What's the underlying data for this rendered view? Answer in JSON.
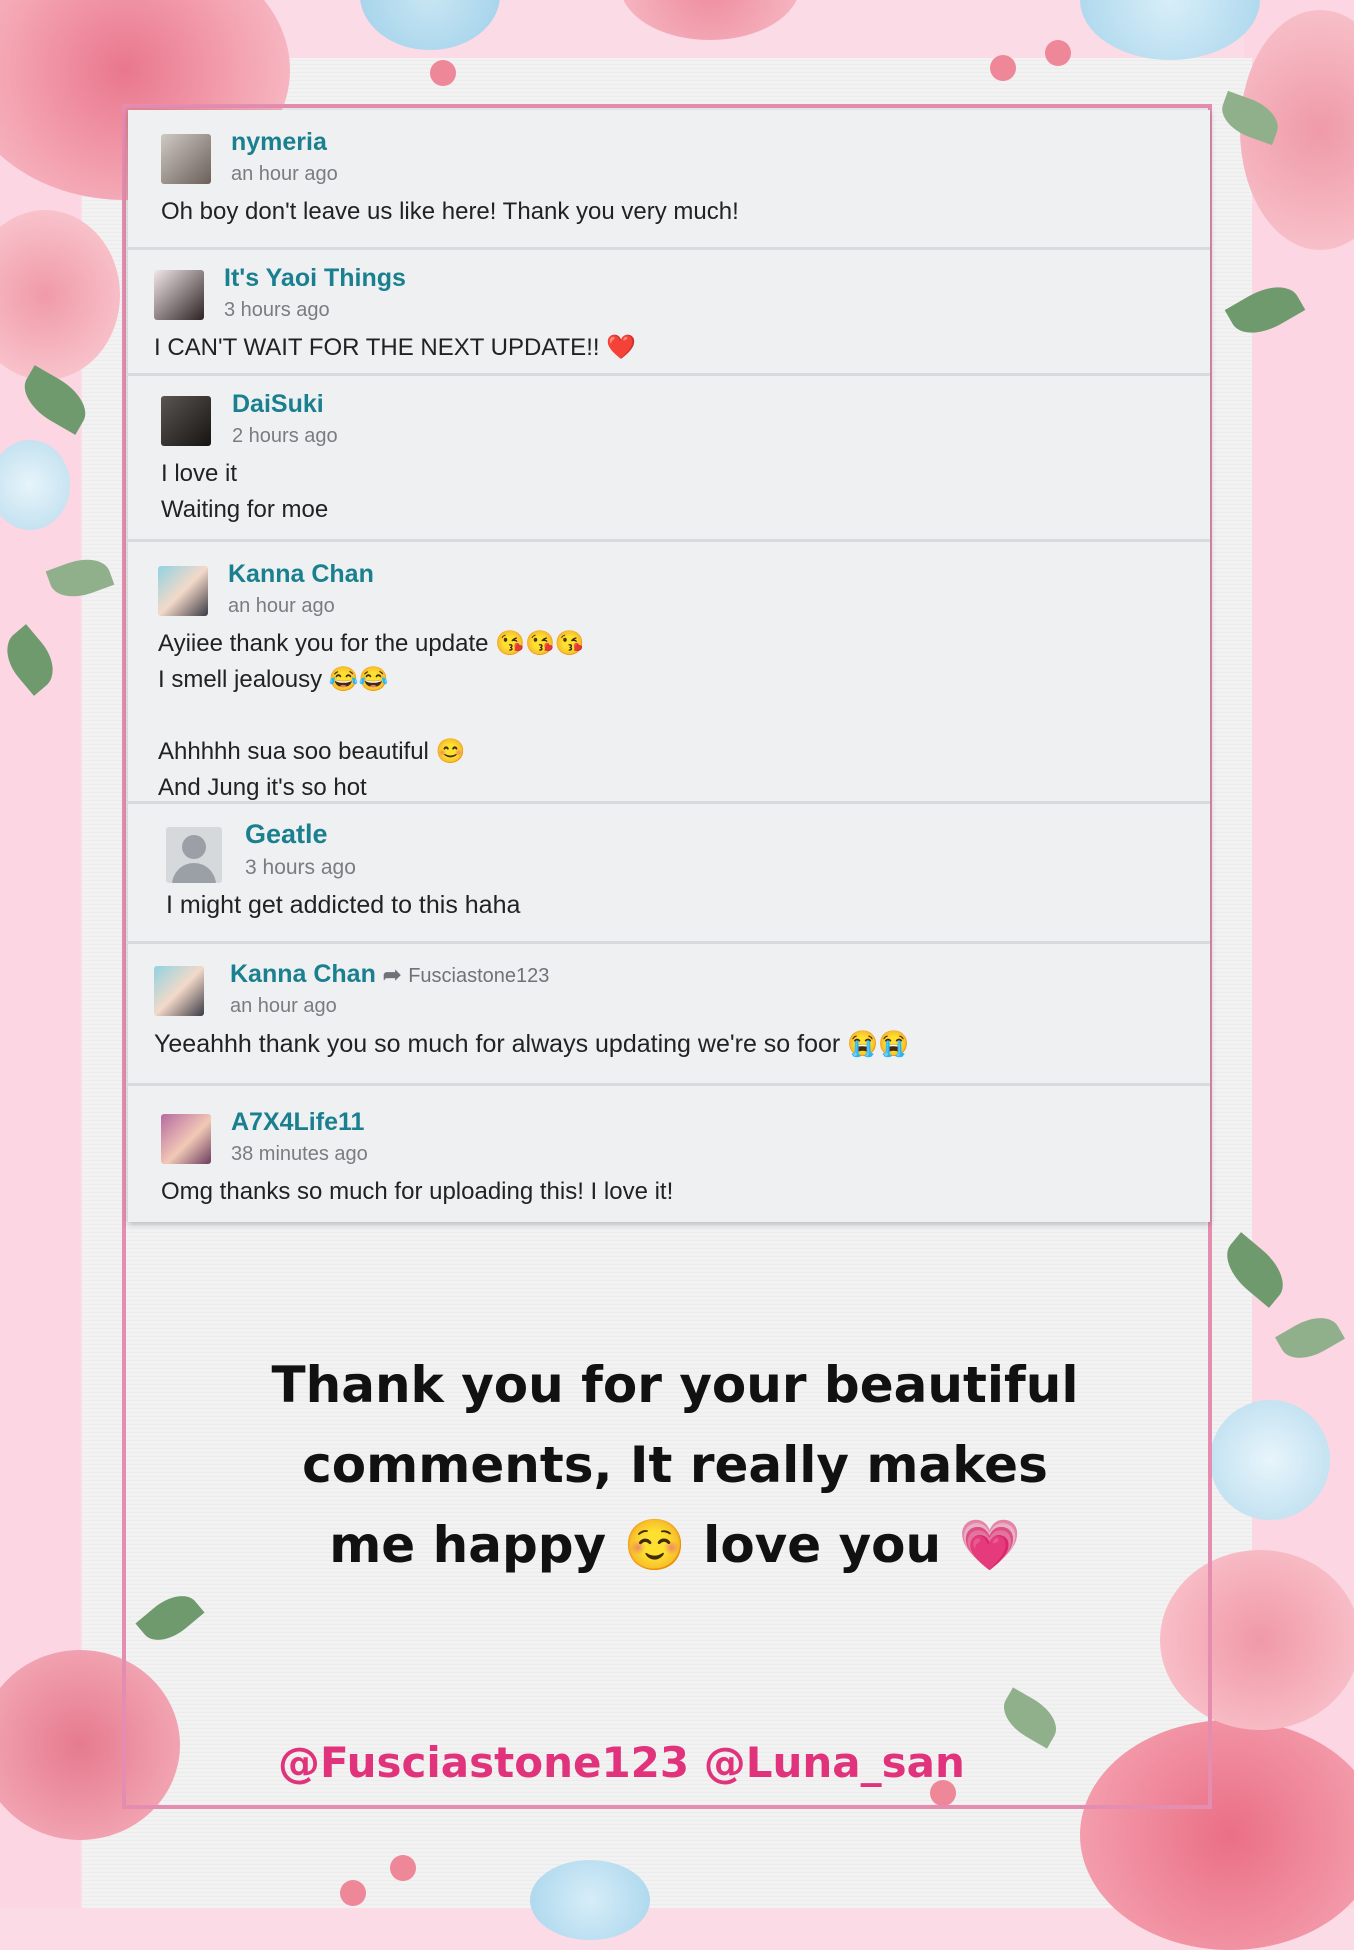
{
  "comments": [
    {
      "username": "nymeria",
      "time": "an hour ago",
      "text": "Oh boy don't leave us like here! Thank you very much!"
    },
    {
      "username": "It's Yaoi Things",
      "time": "3 hours ago",
      "text": "I CAN'T WAIT FOR THE NEXT UPDATE!! ❤️"
    },
    {
      "username": "DaiSuki",
      "time": "2 hours ago",
      "text": "I love it\nWaiting for moe"
    },
    {
      "username": "Kanna Chan",
      "time": "an hour ago",
      "text": "Ayiiee thank you for the update 😘😘😘\nI smell jealousy 😂😂\n\nAhhhhh sua soo beautiful 😊\nAnd Jung it's so hot"
    },
    {
      "username": "Geatle",
      "time": "3 hours ago",
      "text": "I might get addicted to this haha"
    },
    {
      "username": "Kanna Chan",
      "reply_to": "Fusciastone123",
      "time": "an hour ago",
      "text": "Yeeahhh thank you so much for always updating we're so foor 😭😭"
    },
    {
      "username": "A7X4Life11",
      "time": "38 minutes ago",
      "text": "Omg thanks so much for uploading this! I love it!"
    }
  ],
  "thanks_message": "Thank you for your beautiful\ncomments, It really makes\nme happy ☺️ love you 💗",
  "credits": "@Fusciastone123  @Luna_san",
  "icons": {
    "reply": "reply-arrow-icon"
  }
}
